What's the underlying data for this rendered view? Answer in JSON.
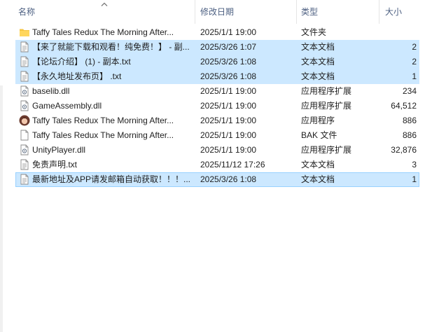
{
  "columns": {
    "name": "名称",
    "date": "修改日期",
    "type": "类型",
    "size": "大小"
  },
  "files": [
    {
      "name": "Taffy Tales Redux The Morning After...",
      "date": "2025/1/1 19:00",
      "type": "文件夹",
      "size": "",
      "icon": "folder-icon",
      "selected": false
    },
    {
      "name": "【来了就能下载和观看！纯免费！】 - 副...",
      "date": "2025/3/26 1:07",
      "type": "文本文档",
      "size": "2",
      "icon": "text-file-icon",
      "selected": true
    },
    {
      "name": "【论坛介绍】 (1) - 副本.txt",
      "date": "2025/3/26 1:08",
      "type": "文本文档",
      "size": "2",
      "icon": "text-file-icon",
      "selected": true
    },
    {
      "name": "【永久地址发布页】 .txt",
      "date": "2025/3/26 1:08",
      "type": "文本文档",
      "size": "1",
      "icon": "text-file-icon",
      "selected": true
    },
    {
      "name": "baselib.dll",
      "date": "2025/1/1 19:00",
      "type": "应用程序扩展",
      "size": "234",
      "icon": "dll-file-icon",
      "selected": false
    },
    {
      "name": "GameAssembly.dll",
      "date": "2025/1/1 19:00",
      "type": "应用程序扩展",
      "size": "64,512",
      "icon": "dll-file-icon",
      "selected": false
    },
    {
      "name": "Taffy Tales Redux The Morning After...",
      "date": "2025/1/1 19:00",
      "type": "应用程序",
      "size": "886",
      "icon": "app-avatar-icon",
      "selected": false
    },
    {
      "name": "Taffy Tales Redux The Morning After...",
      "date": "2025/1/1 19:00",
      "type": "BAK 文件",
      "size": "886",
      "icon": "blank-file-icon",
      "selected": false
    },
    {
      "name": "UnityPlayer.dll",
      "date": "2025/1/1 19:00",
      "type": "应用程序扩展",
      "size": "32,876",
      "icon": "dll-file-icon",
      "selected": false
    },
    {
      "name": "免责声明.txt",
      "date": "2025/11/12 17:26",
      "type": "文本文档",
      "size": "3",
      "icon": "text-file-icon",
      "selected": false
    },
    {
      "name": "最新地址及APP请发邮箱自动获取！！！...",
      "date": "2025/3/26 1:08",
      "type": "文本文档",
      "size": "1",
      "icon": "text-file-icon",
      "selected": true
    }
  ]
}
